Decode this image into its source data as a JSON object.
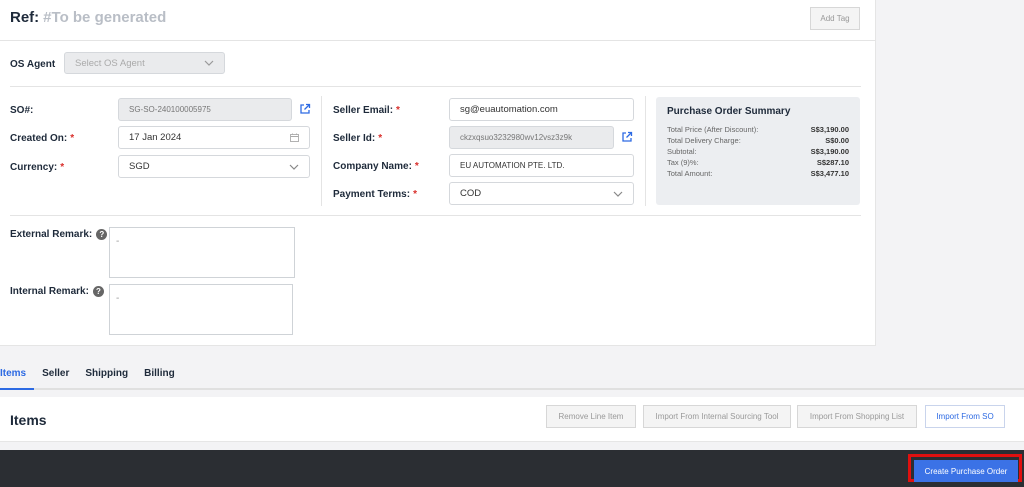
{
  "header": {
    "ref_label": "Ref:",
    "ref_value": "#To be generated",
    "add_tag": "Add Tag"
  },
  "os_agent": {
    "label": "OS Agent",
    "placeholder": "Select OS Agent"
  },
  "form": {
    "so_label": "SO#:",
    "so_value": "SG-SO-240100005975",
    "created_label": "Created On:",
    "created_value": "17 Jan 2024",
    "currency_label": "Currency:",
    "currency_value": "SGD",
    "seller_email_label": "Seller Email:",
    "seller_email_value": "sg@euautomation.com",
    "seller_id_label": "Seller Id:",
    "seller_id_value": "ckzxqsuo3232980wv12vsz3z9k",
    "company_label": "Company Name:",
    "company_value": "EU AUTOMATION PTE. LTD.",
    "payment_label": "Payment Terms:",
    "payment_value": "COD",
    "required_mark": "*"
  },
  "summary": {
    "title": "Purchase Order Summary",
    "rows": [
      {
        "label": "Total Price (After Discount):",
        "value": "S$3,190.00"
      },
      {
        "label": "Total Delivery Charge:",
        "value": "S$0.00"
      },
      {
        "label": "Subtotal:",
        "value": "S$3,190.00"
      },
      {
        "label": "Tax (9)%:",
        "value": "S$287.10"
      },
      {
        "label": "Total Amount:",
        "value": "S$3,477.10"
      }
    ]
  },
  "remarks": {
    "external_label": "External Remark:",
    "external_value": "-",
    "internal_label": "Internal Remark:",
    "internal_value": "-",
    "help": "?"
  },
  "tabs": [
    "Items",
    "Seller",
    "Shipping",
    "Billing"
  ],
  "items": {
    "title": "Items",
    "remove": "Remove Line Item",
    "import_internal": "Import From Internal Sourcing Tool",
    "import_shopping": "Import From Shopping List",
    "import_so": "Import From SO"
  },
  "footer": {
    "create": "Create Purchase Order"
  },
  "colors": {
    "accent": "#2d6ae3",
    "required": "#d9302c",
    "footer_bg": "#2b2e33",
    "highlight": "#e0100f"
  },
  "icons": [
    "external-link-icon",
    "calendar-icon",
    "chevron-down-icon",
    "help-icon"
  ]
}
